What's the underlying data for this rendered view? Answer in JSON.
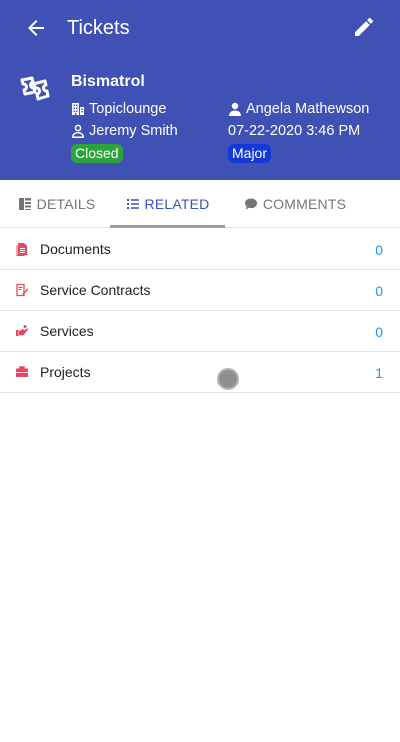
{
  "appbar": {
    "title": "Tickets",
    "back_icon": "arrow-left-icon",
    "edit_icon": "pencil-icon"
  },
  "ticket": {
    "name": "Bismatrol",
    "organization": "Topiclounge",
    "assignee": "Angela Mathewson",
    "contact": "Jeremy Smith",
    "datetime": "07-22-2020 3:46 PM",
    "status": "Closed",
    "priority": "Major"
  },
  "tabs": [
    {
      "label": "DETAILS",
      "icon": "details-icon"
    },
    {
      "label": "RELATED",
      "icon": "list-icon",
      "active": true
    },
    {
      "label": "COMMENTS",
      "icon": "comment-icon"
    }
  ],
  "related": [
    {
      "label": "Documents",
      "count": "0",
      "icon": "document-icon"
    },
    {
      "label": "Service Contracts",
      "count": "0",
      "icon": "contract-icon"
    },
    {
      "label": "Services",
      "count": "0",
      "icon": "services-icon"
    },
    {
      "label": "Projects",
      "count": "1",
      "icon": "briefcase-icon"
    }
  ],
  "colors": {
    "primary": "#3f51b5",
    "status_closed": "#2aa53a",
    "priority_major": "#1538d8",
    "count": "#2196f3",
    "related_icon": "#e8475f"
  }
}
